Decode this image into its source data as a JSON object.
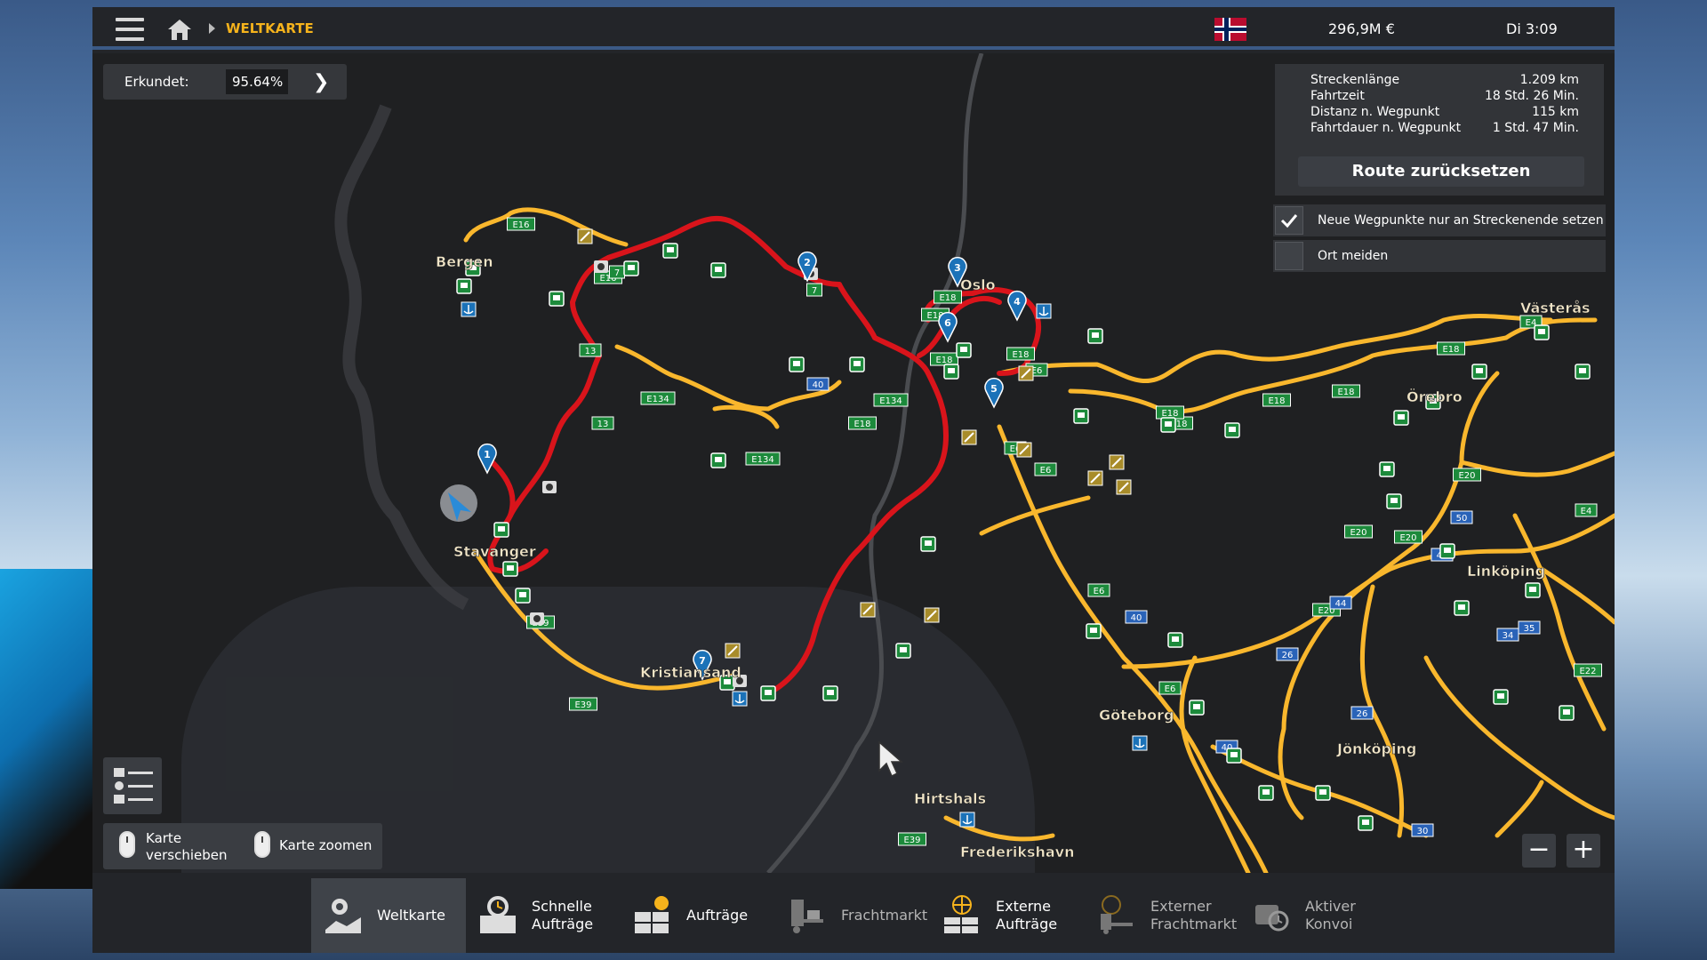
{
  "topbar": {
    "breadcrumb": "WELTKARTE",
    "money": "296,9M €",
    "time": "Di 3:09"
  },
  "explored": {
    "label": "Erkundet:",
    "value": "95.64%"
  },
  "route_info": [
    {
      "key": "Streckenlänge",
      "value": "1.209 km"
    },
    {
      "key": "Fahrtzeit",
      "value": "18 Std. 26 Min."
    },
    {
      "key": "Distanz n. Wegpunkt",
      "value": "115 km"
    },
    {
      "key": "Fahrtdauer n. Wegpunkt",
      "value": "1 Std. 47 Min."
    }
  ],
  "reset_label": "Route zurücksetzen",
  "options": [
    {
      "label": "Neue Wegpunkte nur an Streckenende setzen",
      "checked": true
    },
    {
      "label": "Ort meiden",
      "checked": false
    }
  ],
  "hints": {
    "move_line1": "Karte",
    "move_line2": "verschieben",
    "zoom": "Karte zoomen"
  },
  "zoom": {
    "minus": "−",
    "plus": "+"
  },
  "cities": [
    "Bergen",
    "Oslo",
    "Västerås",
    "Örebro",
    "Stavanger",
    "Linköping",
    "Kristiansand",
    "Göteborg",
    "Jönköping",
    "Hirtshals",
    "Frederikshavn"
  ],
  "waypoints": [
    "1",
    "2",
    "3",
    "4",
    "5",
    "6",
    "7"
  ],
  "road_signs": [
    "E16",
    "E16",
    "E134",
    "E134",
    "E134",
    "E18",
    "E18",
    "E18",
    "E18",
    "E18",
    "E18",
    "E18",
    "E18",
    "E18",
    "E18",
    "E6",
    "E6",
    "E6",
    "E6",
    "E6",
    "E4",
    "E4",
    "E20",
    "E20",
    "E20",
    "E20",
    "E22",
    "E39",
    "E39",
    "E39",
    "13",
    "13",
    "7",
    "7",
    "40",
    "40",
    "40",
    "44",
    "26",
    "26",
    "47",
    "34",
    "35",
    "50",
    "30"
  ],
  "tabs": [
    {
      "line1": "Weltkarte",
      "line2": ""
    },
    {
      "line1": "Schnelle",
      "line2": "Aufträge"
    },
    {
      "line1": "Aufträge",
      "line2": ""
    },
    {
      "line1": "Frachtmarkt",
      "line2": ""
    },
    {
      "line1": "Externe",
      "line2": "Aufträge"
    },
    {
      "line1": "Externer",
      "line2": "Frachtmarkt"
    },
    {
      "line1": "Aktiver",
      "line2": "Konvoi"
    }
  ],
  "colors": {
    "accent": "#f6b31c",
    "route": "#d9141b",
    "road": "#f9b72d",
    "depot": "#1c8a3b",
    "panel": "#323438"
  }
}
